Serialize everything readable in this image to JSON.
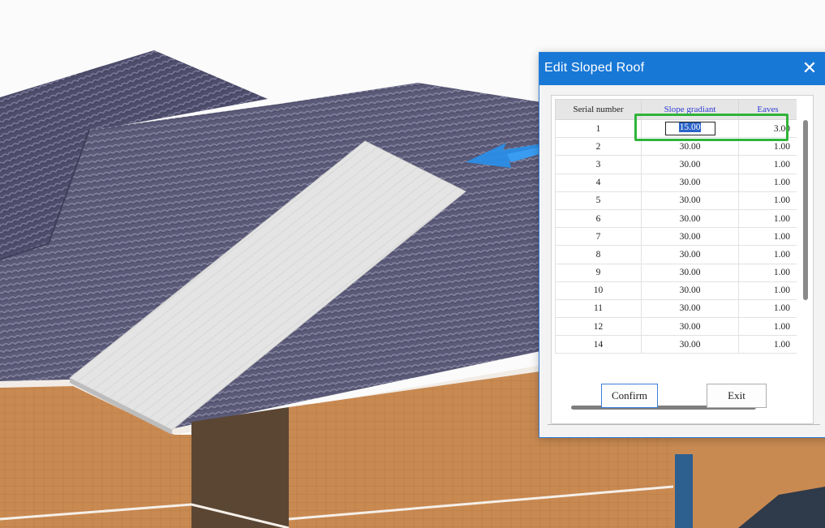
{
  "dialog": {
    "title": "Edit Sloped Roof",
    "close_glyph": "✕",
    "columns": [
      "Serial number",
      "Slope gradiant",
      "Eaves"
    ],
    "rows": [
      {
        "serial": "1",
        "slope": "15.00",
        "eaves": "3.00"
      },
      {
        "serial": "2",
        "slope": "30.00",
        "eaves": "1.00"
      },
      {
        "serial": "3",
        "slope": "30.00",
        "eaves": "1.00"
      },
      {
        "serial": "4",
        "slope": "30.00",
        "eaves": "1.00"
      },
      {
        "serial": "5",
        "slope": "30.00",
        "eaves": "1.00"
      },
      {
        "serial": "6",
        "slope": "30.00",
        "eaves": "1.00"
      },
      {
        "serial": "7",
        "slope": "30.00",
        "eaves": "1.00"
      },
      {
        "serial": "8",
        "slope": "30.00",
        "eaves": "1.00"
      },
      {
        "serial": "9",
        "slope": "30.00",
        "eaves": "1.00"
      },
      {
        "serial": "10",
        "slope": "30.00",
        "eaves": "1.00"
      },
      {
        "serial": "11",
        "slope": "30.00",
        "eaves": "1.00"
      },
      {
        "serial": "12",
        "slope": "30.00",
        "eaves": "1.00"
      },
      {
        "serial": "14",
        "slope": "30.00",
        "eaves": "1.00"
      }
    ],
    "confirm_label": "Confirm",
    "exit_label": "Exit"
  },
  "colors": {
    "titlebar": "#1878d6",
    "highlight": "#2fb43a",
    "arrow": "#2a8ee6",
    "roof_tile": "#5a5a78",
    "wall": "#c9874f"
  }
}
